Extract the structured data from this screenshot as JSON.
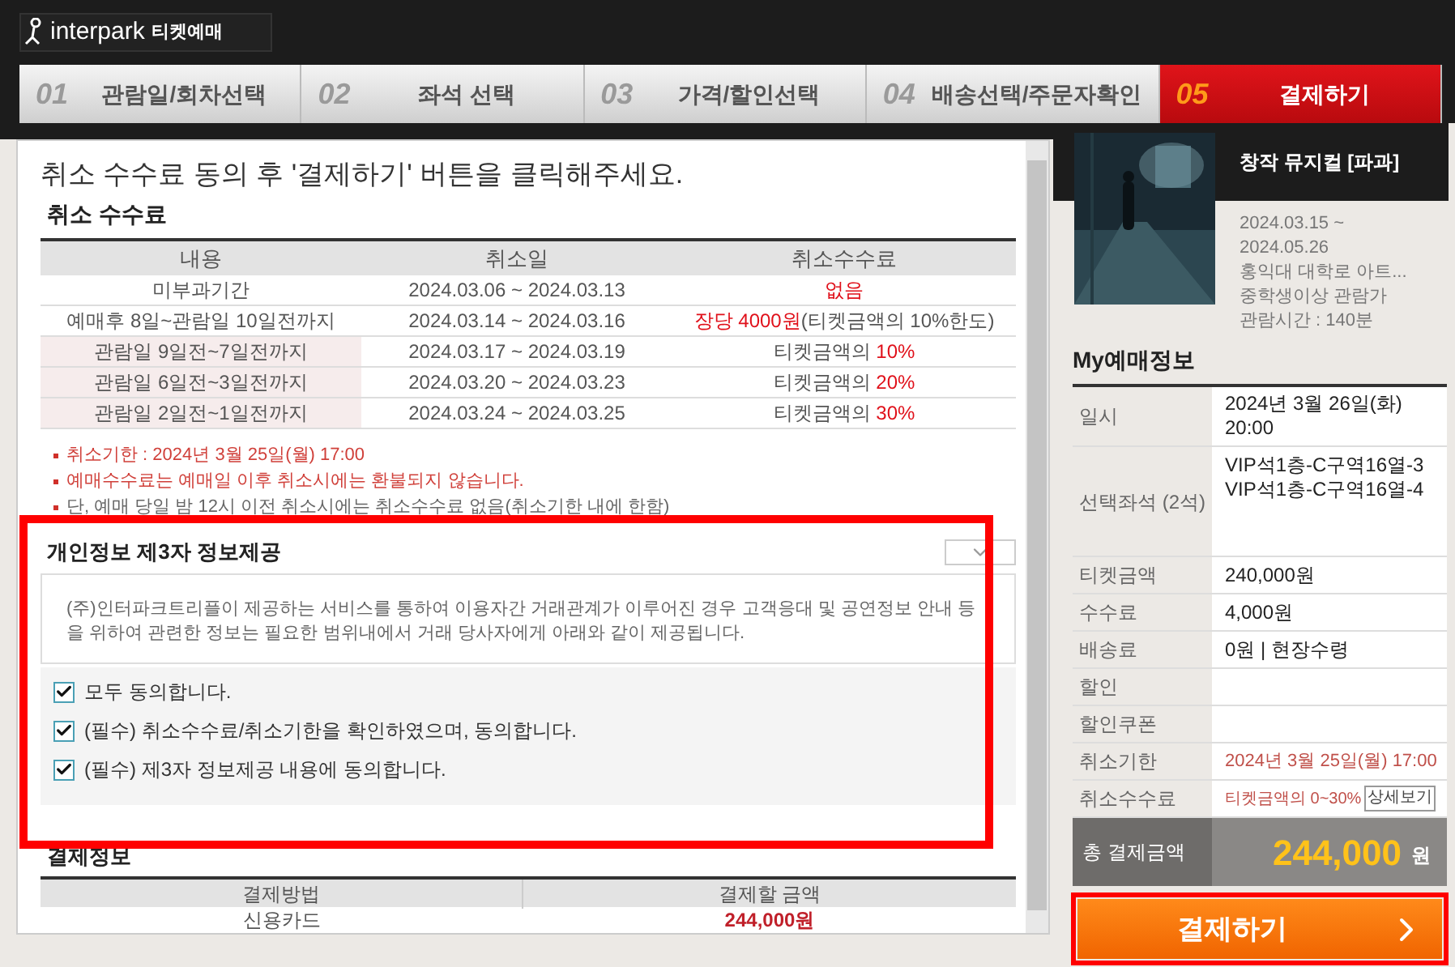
{
  "header": {
    "brand": "interpark",
    "service": "티켓예매"
  },
  "steps": [
    {
      "number": "01",
      "label": "관람일/회차선택",
      "selected": false
    },
    {
      "number": "02",
      "label": "좌석 선택",
      "selected": false
    },
    {
      "number": "03",
      "label": "가격/할인선택",
      "selected": false
    },
    {
      "number": "04",
      "label": "배송선택/주문자확인",
      "selected": false
    },
    {
      "number": "05",
      "label": "결제하기",
      "selected": true
    }
  ],
  "instruction": "취소 수수료 동의 후 '결제하기' 버튼을 클릭해주세요.",
  "cancel_fee": {
    "title": "취소 수수료",
    "columns": [
      "내용",
      "취소일",
      "취소수수료"
    ],
    "rows": [
      {
        "period": "미부과기간",
        "shaded": false,
        "dates": "2024.03.06 ~ 2024.03.13",
        "fee": [
          {
            "text": "없음",
            "highlight": true
          }
        ]
      },
      {
        "period": "예매후 8일~관람일 10일전까지",
        "shaded": false,
        "dates": "2024.03.14 ~ 2024.03.16",
        "fee": [
          {
            "text": "장당 4000원",
            "highlight": true
          },
          {
            "text": "(티켓금액의 10%한도)",
            "highlight": false
          }
        ]
      },
      {
        "period": "관람일 9일전~7일전까지",
        "shaded": true,
        "dates": "2024.03.17 ~ 2024.03.19",
        "fee": [
          {
            "text": "티켓금액의 ",
            "highlight": false
          },
          {
            "text": "10%",
            "highlight": true
          }
        ]
      },
      {
        "period": "관람일 6일전~3일전까지",
        "shaded": true,
        "dates": "2024.03.20 ~ 2024.03.23",
        "fee": [
          {
            "text": "티켓금액의 ",
            "highlight": false
          },
          {
            "text": "20%",
            "highlight": true
          }
        ]
      },
      {
        "period": "관람일 2일전~1일전까지",
        "shaded": true,
        "dates": "2024.03.24 ~ 2024.03.25",
        "fee": [
          {
            "text": "티켓금액의 ",
            "highlight": false
          },
          {
            "text": "30%",
            "highlight": true
          }
        ]
      }
    ],
    "notes": [
      {
        "text": "취소기한 : 2024년 3월 25일(월) 17:00",
        "highlight": true
      },
      {
        "text": "예매수수료는 예매일 이후 취소시에는 환불되지 않습니다.",
        "highlight": true
      },
      {
        "text": "단, 예매 당일 밤 12시 이전 취소시에는 취소수수료 없음(취소기한 내에 한함)",
        "highlight": false
      }
    ]
  },
  "privacy": {
    "title": "개인정보 제3자 정보제공",
    "expanded": true,
    "text": "(주)인터파크트리플이 제공하는 서비스를 통하여 이용자간 거래관계가 이루어진 경우 고객응대 및 공연정보 안내 등을 위하여 관련한 정보는 필요한 범위내에서 거래 당사자에게 아래와 같이 제공됩니다.",
    "agreements": [
      {
        "label": "모두 동의합니다.",
        "checked": true
      },
      {
        "label": "(필수) 취소수수료/취소기한을 확인하였으며, 동의합니다.",
        "checked": true
      },
      {
        "label": "(필수) 제3자 정보제공 내용에 동의합니다.",
        "checked": true
      }
    ]
  },
  "payment_info": {
    "title": "결제정보",
    "columns": [
      "결제방법",
      "결제할 금액"
    ],
    "rows": [
      {
        "method": "신용카드",
        "amount": "244,000원"
      }
    ]
  },
  "show": {
    "title": "창작 뮤지컬 [파과]",
    "details": [
      "2024.03.15 ~",
      "2024.05.26",
      "홍익대 대학로 아트...",
      "중학생이상 관람가",
      "관람시간 : 140분"
    ]
  },
  "my_booking": {
    "title": "My예매정보",
    "rows": [
      {
        "kind": "plain",
        "label": "일시",
        "value": "2024년 3월 26일(화) 20:00"
      },
      {
        "kind": "seats",
        "label": "선택좌석 (2석)",
        "values": [
          "VIP석1층-C구역16열-3",
          "VIP석1층-C구역16열-4"
        ]
      },
      {
        "kind": "plain",
        "label": "티켓금액",
        "value": "240,000원"
      },
      {
        "kind": "plain",
        "label": "수수료",
        "value": "4,000원"
      },
      {
        "kind": "plain",
        "label": "배송료",
        "value": "0원 | 현장수령"
      },
      {
        "kind": "plain",
        "label": "할인"
      },
      {
        "kind": "plain",
        "label": "할인쿠폰"
      },
      {
        "kind": "alert",
        "label": "취소기한",
        "value": "2024년 3월 25일(월) 17:00"
      },
      {
        "kind": "detail",
        "label": "취소수수료",
        "value": "티켓금액의 0~30%",
        "button": "상세보기"
      }
    ],
    "total_label": "총 결제금액",
    "total_amount": "244,000",
    "total_unit": "원"
  },
  "pay_button": "결제하기"
}
